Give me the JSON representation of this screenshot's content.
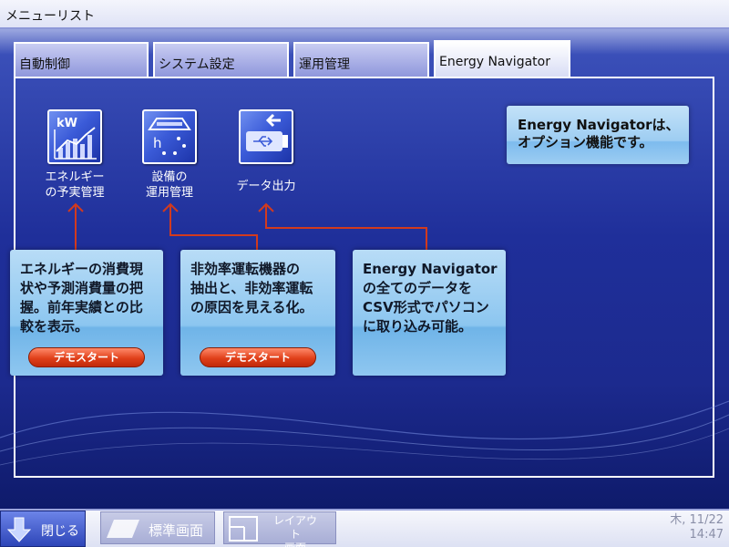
{
  "window": {
    "title": "メニューリスト"
  },
  "tabs": [
    {
      "label": "自動制御",
      "active": false
    },
    {
      "label": "システム設定",
      "active": false
    },
    {
      "label": "運用管理",
      "active": false
    },
    {
      "label": "Energy Navigator",
      "active": true
    }
  ],
  "tools": [
    {
      "label": "エネルギー\nの予実管理",
      "icon": "kw-chart-icon"
    },
    {
      "label": "設備の\n運用管理",
      "icon": "equipment-icon"
    },
    {
      "label": "データ出力",
      "icon": "usb-export-icon"
    }
  ],
  "callouts": [
    {
      "text": "エネルギーの消費現\n状や予測消費量の把\n握。前年実績との比\n較を表示。",
      "button": "デモスタート"
    },
    {
      "text": "非効率運転機器の\n抽出と、非効率運転\nの原因を見える化。",
      "button": "デモスタート"
    },
    {
      "text": "Energy Navigator\nの全てのデータを\nCSV形式でパソコン\nに取り込み可能。"
    }
  ],
  "info_box": {
    "text": "Energy Navigatorは、\nオプション機能です。"
  },
  "bottom_bar": {
    "close_label": "閉じる",
    "standard_screen_label": "標準画面",
    "layout_screen_label_1": "レイアウト",
    "layout_screen_label_2": "画面",
    "date": "木, 11/22",
    "time": "14:47"
  },
  "colors": {
    "accent": "#1f2f9a",
    "arrow": "#d23a1e",
    "callout": "#9dcdf2",
    "demo_button": "#e0401a"
  }
}
